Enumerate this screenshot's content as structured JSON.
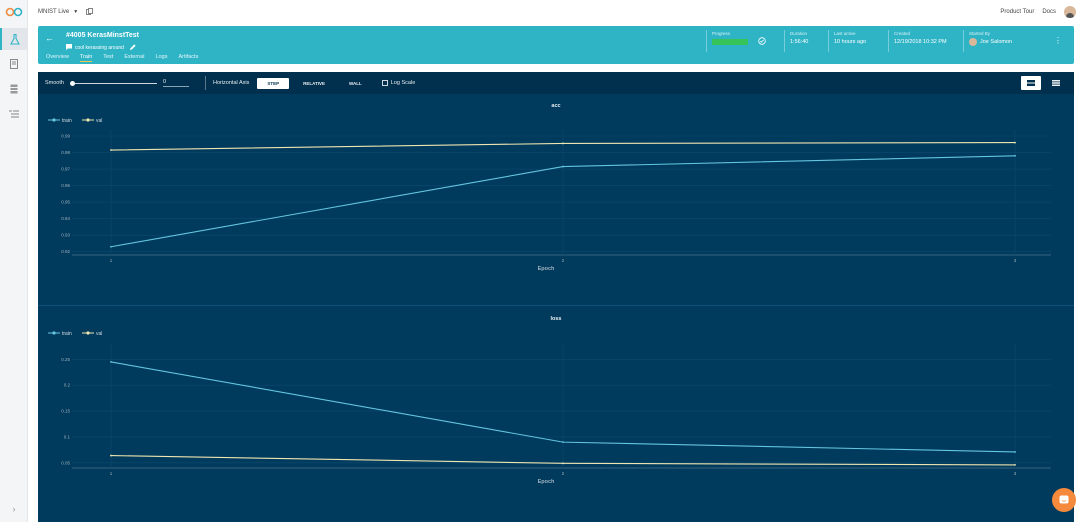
{
  "app": {
    "project_name": "MNIST Live",
    "top_links": [
      "Product Tour",
      "Docs"
    ]
  },
  "experiment": {
    "title": "#4005 KerasMinstTest",
    "comment": "cool kerassing around",
    "tabs": [
      {
        "label": "Overview",
        "active": false
      },
      {
        "label": "Train",
        "active": true
      },
      {
        "label": "Test",
        "active": false
      },
      {
        "label": "External",
        "active": false
      },
      {
        "label": "Logs",
        "active": false
      },
      {
        "label": "Artifacts",
        "active": false
      }
    ],
    "info": {
      "progress_label": "Progress",
      "progress_value": 1.0,
      "duration_label": "Duration",
      "duration": "1:56:40",
      "last_active_label": "Last active",
      "last_active": "10 hours ago",
      "created_label": "Created",
      "created": "12/19/2018 10:32 PM",
      "started_by_label": "Started By",
      "started_by": "Joe Salomon"
    }
  },
  "toolbar": {
    "smooth_label": "Smooth",
    "smooth_value": "0",
    "horizontal_axis_label": "Horizontal Axis",
    "axis_options": [
      {
        "label": "STEP",
        "active": true
      },
      {
        "label": "RELATIVE",
        "active": false
      },
      {
        "label": "WALL",
        "active": false
      }
    ],
    "log_scale_label": "Log Scale",
    "log_scale_checked": false
  },
  "colors": {
    "accent": "#2fb4c6",
    "panel": "#003a5c",
    "train": "#63c5e0",
    "val": "#efe5b0",
    "progress": "#36c45a"
  },
  "chart_data": [
    {
      "type": "line",
      "title": "acc",
      "xlabel": "Epoch",
      "ylabel": "",
      "x": [
        1,
        2,
        3
      ],
      "xticks": [
        "1",
        "2",
        "3"
      ],
      "yticks": [
        "0.92",
        "0.93",
        "0.94",
        "0.95",
        "0.96",
        "0.97",
        "0.98",
        "0.99"
      ],
      "ylim": [
        0.918,
        0.99
      ],
      "grid": true,
      "legend_position": "top-left",
      "series": [
        {
          "name": "train",
          "color": "#63c5e0",
          "values": [
            0.923,
            0.9715,
            0.978
          ]
        },
        {
          "name": "val",
          "color": "#efe5b0",
          "values": [
            0.9815,
            0.9855,
            0.986
          ]
        }
      ]
    },
    {
      "type": "line",
      "title": "loss",
      "xlabel": "Epoch",
      "ylabel": "",
      "x": [
        1,
        2,
        3
      ],
      "xticks": [
        "1",
        "2",
        "3"
      ],
      "yticks": [
        "0.05",
        "0.1",
        "0.15",
        "0.2",
        "0.25"
      ],
      "ylim": [
        0.04,
        0.27
      ],
      "grid": true,
      "legend_position": "top-left",
      "series": [
        {
          "name": "train",
          "color": "#63c5e0",
          "values": [
            0.245,
            0.09,
            0.071
          ]
        },
        {
          "name": "val",
          "color": "#efe5b0",
          "values": [
            0.064,
            0.049,
            0.046
          ]
        }
      ]
    }
  ]
}
